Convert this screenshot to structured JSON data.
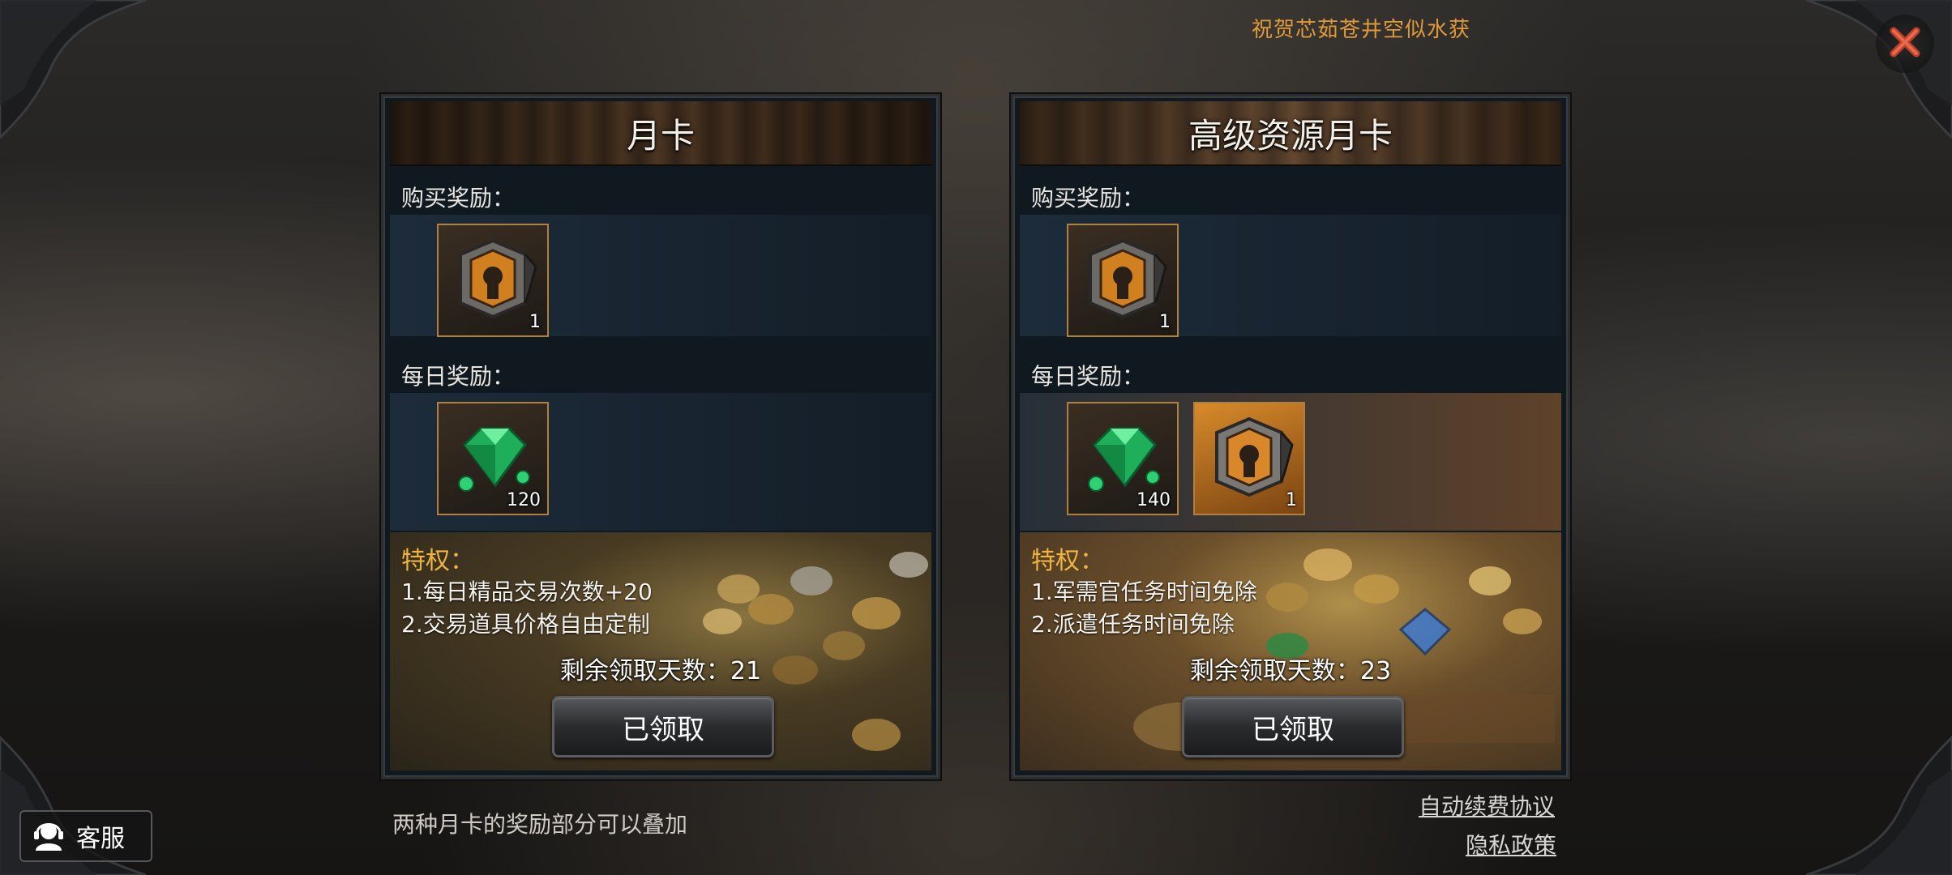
{
  "banner": {
    "text": "祝贺芯茹苍井空似水获"
  },
  "panels": [
    {
      "title": "月卡",
      "purchase_label": "购买奖励：",
      "purchase_items": [
        {
          "icon": "treasure-chest-icon",
          "count": "1"
        }
      ],
      "daily_label": "每日奖励：",
      "daily_items": [
        {
          "icon": "emerald-gem-icon",
          "count": "120"
        }
      ],
      "privilege_title": "特权：",
      "privileges": [
        "1.每日精品交易次数+20",
        "2.交易道具价格自由定制"
      ],
      "remaining_days": "剩余领取天数：21",
      "claim_button": "已领取"
    },
    {
      "title": "高级资源月卡",
      "purchase_label": "购买奖励：",
      "purchase_items": [
        {
          "icon": "treasure-chest-icon",
          "count": "1"
        }
      ],
      "daily_label": "每日奖励：",
      "daily_items": [
        {
          "icon": "emerald-gem-icon",
          "count": "140"
        },
        {
          "icon": "treasure-chest-icon",
          "count": "1"
        }
      ],
      "privilege_title": "特权：",
      "privileges": [
        "1.军需官任务时间免除",
        "2.派遣任务时间免除"
      ],
      "remaining_days": "剩余领取天数：23",
      "claim_button": "已领取"
    }
  ],
  "footer": {
    "note": "两种月卡的奖励部分可以叠加",
    "renew_link": "自动续费协议",
    "privacy_link": "隐私政策"
  },
  "service": {
    "label": "客服",
    "icon": "headset-icon"
  },
  "close": {
    "icon": "close-icon"
  },
  "colors": {
    "banner": "#e09a3a",
    "privilege_title": "#f0b440",
    "item_border": "#b08040"
  }
}
